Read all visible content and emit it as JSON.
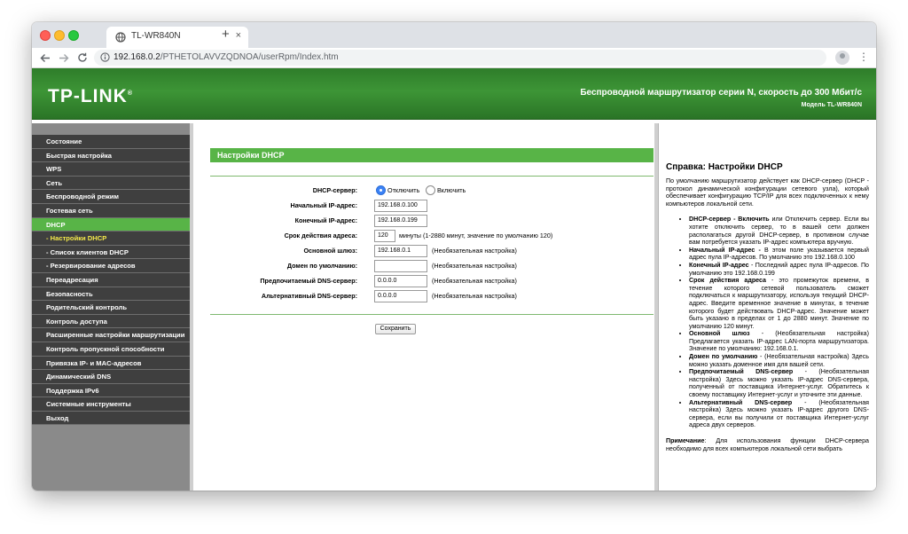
{
  "browser": {
    "tab_title": "TL-WR840N",
    "new_tab": "+",
    "tab_close": "×",
    "url_host": "192.168.0.2",
    "url_path": "/PTHETOLAVVZQDNOA/userRpm/Index.htm"
  },
  "banner": {
    "logo": "TP-LINK",
    "logo_mark": "®",
    "title": "Беспроводной маршрутизатор серии N, скорость до 300 Мбит/с",
    "model": "Модель TL-WR840N"
  },
  "sidebar": {
    "items": [
      {
        "label": "Состояние",
        "active": false
      },
      {
        "label": "Быстрая настройка",
        "active": false
      },
      {
        "label": "WPS",
        "active": false
      },
      {
        "label": "Сеть",
        "active": false
      },
      {
        "label": "Беспроводной режим",
        "active": false
      },
      {
        "label": "Гостевая сеть",
        "active": false
      },
      {
        "label": "DHCP",
        "active": true
      },
      {
        "label": "- Настройки DHCP",
        "active": true,
        "sub": true
      },
      {
        "label": "- Список клиентов DHCP",
        "active": false,
        "sub": true
      },
      {
        "label": "- Резервирование адресов",
        "active": false,
        "sub": true
      },
      {
        "label": "Переадресация",
        "active": false
      },
      {
        "label": "Безопасность",
        "active": false
      },
      {
        "label": "Родительский контроль",
        "active": false
      },
      {
        "label": "Контроль доступа",
        "active": false
      },
      {
        "label": "Расширенные настройки маршрутизации",
        "active": false
      },
      {
        "label": "Контроль пропускной способности",
        "active": false
      },
      {
        "label": "Привязка IP- и MAC-адресов",
        "active": false
      },
      {
        "label": "Динамический DNS",
        "active": false
      },
      {
        "label": "Поддержка IPv6",
        "active": false
      },
      {
        "label": "Системные инструменты",
        "active": false
      },
      {
        "label": "Выход",
        "active": false
      }
    ]
  },
  "form": {
    "section_title": "Настройки DHCP",
    "dhcp_server_label": "DHCP-сервер:",
    "dhcp_off_label": "Отключить",
    "dhcp_on_label": "Включить",
    "dhcp_selected": "Отключить",
    "start_ip_label": "Начальный IP-адрес:",
    "start_ip_value": "192.168.0.100",
    "end_ip_label": "Конечный IP-адрес:",
    "end_ip_value": "192.168.0.199",
    "lease_label": "Срок действия адреса:",
    "lease_value": "120",
    "lease_note": "минуты (1-2880 минут, значение по умолчанию 120)",
    "gateway_label": "Основной шлюз:",
    "gateway_value": "192.168.0.1",
    "gateway_note": "(Необязательная настройка)",
    "domain_label": "Домен по умолчанию:",
    "domain_value": "",
    "domain_note": "(Необязательная настройка)",
    "primary_dns_label": "Предпочитаемый DNS-сервер:",
    "primary_dns_value": "0.0.0.0",
    "primary_dns_note": "(Необязательная настройка)",
    "secondary_dns_label": "Альтернативный DNS-сервер:",
    "secondary_dns_value": "0.0.0.0",
    "secondary_dns_note": "(Необязательная настройка)",
    "save_label": "Сохранить"
  },
  "help": {
    "title": "Справка: Настройки DHCP",
    "intro": "По умолчанию маршрутизатор действует как DHCP-сервер (DHCP - протокол динамической конфигурации сетевого узла), который обеспечивает конфигурацию TCP/IP для всех подключенных к нему компьютеров локальной сети.",
    "items": [
      {
        "term": "DHCP-сервер - Включить",
        "text": " или Отключить сервер. Если вы хотите отключить сервер, то в вашей сети должен располагаться другой DHCP-сервер, в противном случае вам потребуется указать IP-адрес компьютера вручную.",
        "term2": "Отключить"
      },
      {
        "term": "Начальный IP-адрес -",
        "text": " В этом поле указывается первый адрес пула IP-адресов. По умолчанию это 192.168.0.100"
      },
      {
        "term": "Конечный IP-адрес",
        "text": " - Последний адрес пула IP-адресов. По умолчанию это 192.168.0.199"
      },
      {
        "term": "Срок действия адреса",
        "text": " - это промежуток времени, в течение которого сетевой пользователь сможет подключаться к маршрутизатору, используя текущий DHCP-адрес. Введите временное значение в минутах, в течение которого будет действовать DHCP-адрес. Значение может быть указано в пределах от 1 до 2880 минут. Значение по умолчанию 120 минут."
      },
      {
        "term": "Основной шлюз",
        "text": " - (Необязательная настройка) Предлагается указать IP-адрес LAN-порта маршрутизатора. Значение по умолчанию: 192.168.0.1."
      },
      {
        "term": "Домен по умолчанию",
        "text": " - (Необязательная настройка) Здесь можно указать доменное имя для вашей сети."
      },
      {
        "term": "Предпочитаемый DNS-сервер",
        "text": " - (Необязательная настройка) Здесь можно указать IP-адрес DNS-сервера, полученный от поставщика Интернет-услуг. Обратитесь к своему поставщику Интернет-услуг и уточните эти данные."
      },
      {
        "term": "Альтернативный DNS-сервер",
        "text": " - (Необязательная настройка) Здесь можно указать IP-адрес другого DNS-сервера, если вы получили от поставщика Интернет-услуг адреса двух серверов."
      }
    ],
    "note_term": "Примечание",
    "note_text": ": Для использования функции DHCP-сервера необходимо для всех компьютеров локальной сети выбрать"
  }
}
